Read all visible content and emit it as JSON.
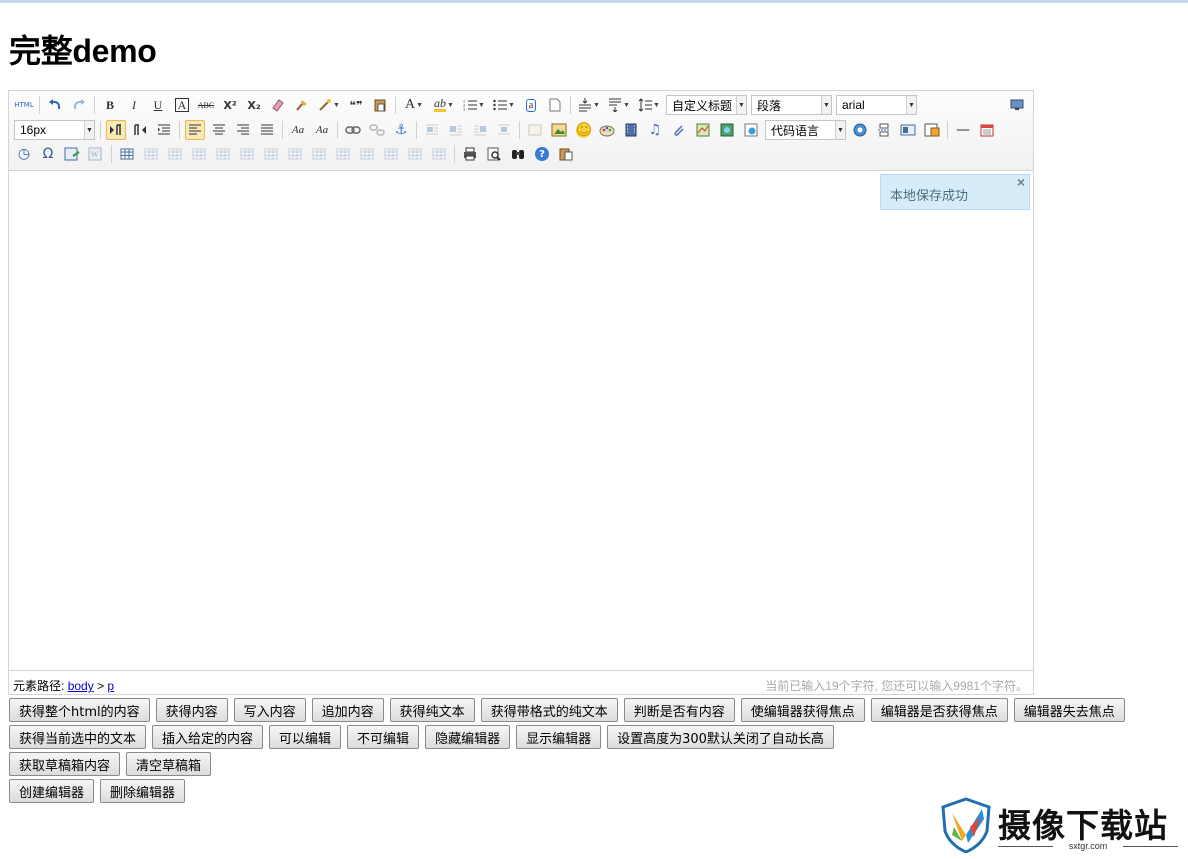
{
  "page": {
    "title": "完整demo"
  },
  "toolbar": {
    "row1": [
      {
        "name": "source-code-icon",
        "label": "HTML"
      },
      {
        "sep": true
      },
      {
        "name": "undo-icon"
      },
      {
        "name": "redo-icon",
        "dim": true
      },
      {
        "sep": true
      },
      {
        "name": "bold-icon",
        "label": "B"
      },
      {
        "name": "italic-icon",
        "label": "I"
      },
      {
        "name": "underline-icon",
        "label": "U"
      },
      {
        "name": "font-border-icon",
        "label": "A"
      },
      {
        "name": "strikethrough-icon",
        "label": "ABC"
      },
      {
        "name": "superscript-icon",
        "label": "X²"
      },
      {
        "name": "subscript-icon",
        "label": "X₂"
      },
      {
        "name": "eraser-icon"
      },
      {
        "name": "format-brush-icon"
      },
      {
        "name": "auto-typeset-icon",
        "dropdown": true
      },
      {
        "name": "blockquote-icon",
        "label": "❝❞"
      },
      {
        "name": "paste-plain-icon"
      },
      {
        "sep": true
      },
      {
        "name": "font-color-icon",
        "label": "A",
        "dropdown": true
      },
      {
        "name": "background-color-icon",
        "label": "ab",
        "dropdown": true
      },
      {
        "name": "ordered-list-icon",
        "dropdown": true
      },
      {
        "name": "unordered-list-icon",
        "dropdown": true
      },
      {
        "name": "select-all-icon",
        "label": "a"
      },
      {
        "name": "clear-document-icon"
      },
      {
        "sep": true
      },
      {
        "name": "row-spacing-top-icon",
        "dropdown": true
      },
      {
        "name": "row-spacing-bottom-icon",
        "dropdown": true
      },
      {
        "name": "line-height-icon",
        "dropdown": true
      }
    ],
    "combos_row1": {
      "custom_title": "自定义标题",
      "paragraph": "段落",
      "font_family": "arial"
    },
    "row2_combo_fontsize": "16px",
    "row2": [
      {
        "name": "ltr-direction-icon",
        "on": true
      },
      {
        "name": "rtl-direction-icon"
      },
      {
        "name": "indent-icon"
      },
      {
        "sep": true
      },
      {
        "name": "align-left-icon",
        "on": true
      },
      {
        "name": "align-center-icon"
      },
      {
        "name": "align-right-icon"
      },
      {
        "name": "align-justify-icon"
      },
      {
        "sep": true
      },
      {
        "name": "uppercase-icon",
        "label": "Aa"
      },
      {
        "name": "lowercase-icon",
        "label": "Aa"
      },
      {
        "sep": true
      },
      {
        "name": "link-icon"
      },
      {
        "name": "unlink-icon",
        "dim": true
      },
      {
        "name": "anchor-icon",
        "label": "⚓"
      },
      {
        "sep": true
      },
      {
        "name": "image-none-icon",
        "dim": true
      },
      {
        "name": "image-left-icon",
        "dim": true
      },
      {
        "name": "image-right-icon",
        "dim": true
      },
      {
        "name": "image-center-icon",
        "dim": true
      },
      {
        "sep": true
      },
      {
        "name": "simple-upload-icon",
        "dim": true
      },
      {
        "name": "insert-image-icon"
      },
      {
        "name": "emotion-icon",
        "label": "☺"
      },
      {
        "name": "scrawl-icon"
      },
      {
        "name": "insert-video-icon"
      },
      {
        "name": "music-icon",
        "label": "♫"
      },
      {
        "name": "attachment-icon"
      },
      {
        "name": "map-icon"
      },
      {
        "name": "google-map-icon"
      },
      {
        "name": "insert-frame-icon"
      }
    ],
    "code_language": "代码语言",
    "row2_tail": [
      {
        "name": "web-app-icon"
      },
      {
        "name": "page-break-icon"
      },
      {
        "name": "template-icon"
      },
      {
        "name": "background-icon"
      },
      {
        "sep": true
      },
      {
        "name": "horizontal-rule-icon",
        "label": "—"
      },
      {
        "name": "date-icon"
      }
    ],
    "row3": [
      {
        "name": "time-icon",
        "label": "◷"
      },
      {
        "name": "special-chars-icon",
        "label": "Ω"
      },
      {
        "name": "wordimage-icon"
      },
      {
        "name": "word-paste-icon",
        "dim": true
      },
      {
        "sep": true
      },
      {
        "name": "insert-table-icon"
      },
      {
        "name": "delete-table-icon",
        "dim": true
      },
      {
        "name": "insert-paragraph-before-table-icon",
        "dim": true
      },
      {
        "name": "insert-row-icon",
        "dim": true
      },
      {
        "name": "delete-row-icon",
        "dim": true
      },
      {
        "name": "insert-col-icon",
        "dim": true
      },
      {
        "name": "delete-col-icon",
        "dim": true
      },
      {
        "name": "merge-cells-icon",
        "dim": true
      },
      {
        "name": "merge-right-icon",
        "dim": true
      },
      {
        "name": "merge-down-icon",
        "dim": true
      },
      {
        "name": "split-to-cells-icon",
        "dim": true
      },
      {
        "name": "split-to-rows-icon",
        "dim": true
      },
      {
        "name": "split-to-cols-icon",
        "dim": true
      },
      {
        "name": "chart-icon",
        "dim": true
      },
      {
        "sep": true
      },
      {
        "name": "print-icon"
      },
      {
        "name": "preview-icon"
      },
      {
        "name": "search-replace-icon"
      },
      {
        "name": "help-icon",
        "label": "?"
      },
      {
        "name": "drafts-icon"
      }
    ]
  },
  "fullscreen": {
    "name": "fullscreen-icon"
  },
  "tip": {
    "text": "本地保存成功",
    "close": "×"
  },
  "statusbar": {
    "path_label": "元素路径:",
    "path_body": "body",
    "path_sep": ">",
    "path_p": "p",
    "count": "当前已输入19个字符, 您还可以输入9981个字符。"
  },
  "buttons": {
    "row1": [
      "获得整个html的内容",
      "获得内容",
      "写入内容",
      "追加内容",
      "获得纯文本",
      "获得带格式的纯文本",
      "判断是否有内容",
      "使编辑器获得焦点",
      "编辑器是否获得焦点",
      "编辑器失去焦点"
    ],
    "row2": [
      "获得当前选中的文本",
      "插入给定的内容",
      "可以编辑",
      "不可编辑",
      "隐藏编辑器",
      "显示编辑器",
      "设置高度为300默认关闭了自动长高"
    ],
    "row3": [
      "获取草稿箱内容",
      "清空草稿箱"
    ],
    "row4": [
      "创建编辑器",
      "删除编辑器"
    ]
  },
  "watermark": {
    "name": "摄像下载站",
    "url": "sxtgr.com"
  },
  "colors": {
    "accent_tip": "#d6ecf8",
    "active_button": "#f7e9b8",
    "link": "#0000cc"
  }
}
